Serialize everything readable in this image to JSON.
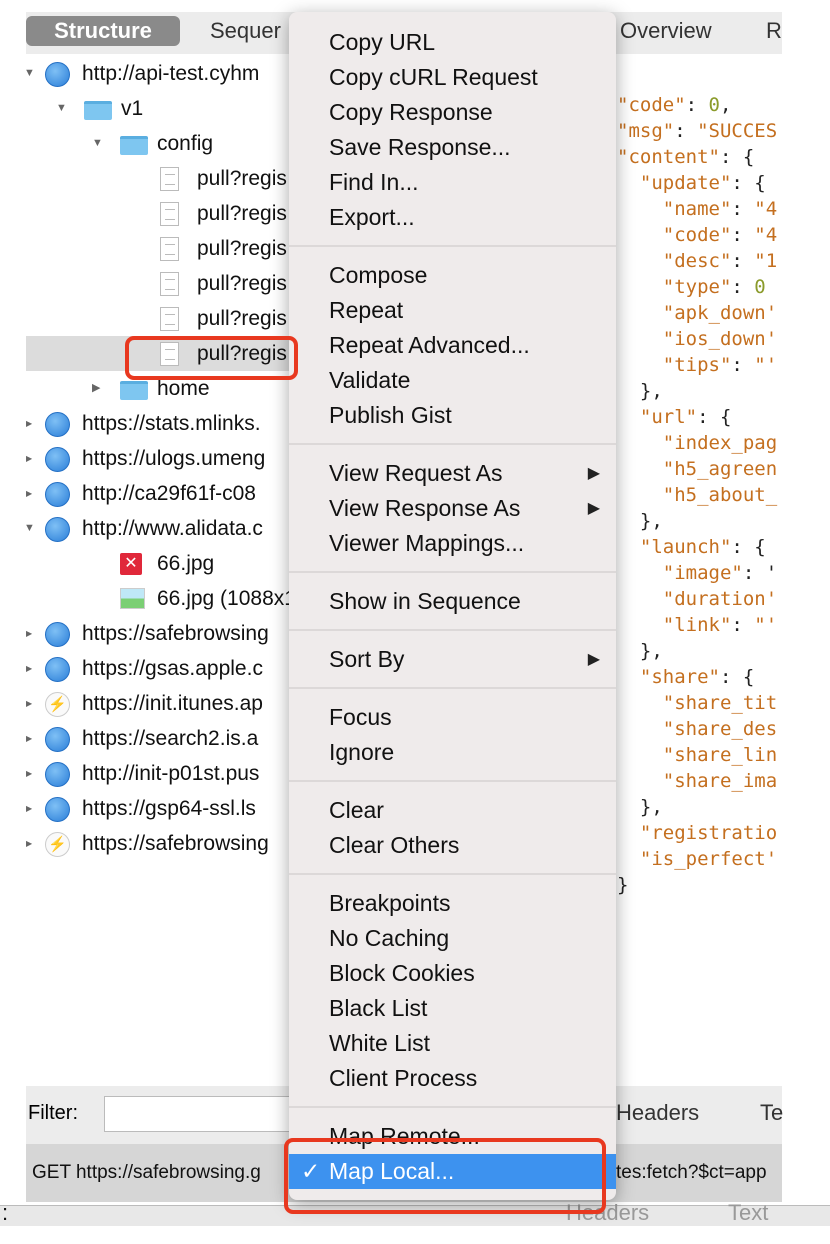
{
  "tabs": {
    "structure": "Structure",
    "sequence": "Sequer",
    "overview": "Overview",
    "r": "R"
  },
  "tree": [
    {
      "label": "http://api-test.cyhm",
      "icon": "globe",
      "indent": 0,
      "expanded": true
    },
    {
      "label": "v1",
      "icon": "folder",
      "indent": 1,
      "expanded": true
    },
    {
      "label": "config",
      "icon": "folder",
      "indent": 2,
      "expanded": true
    },
    {
      "label": "pull?regis",
      "icon": "doc",
      "indent": 3
    },
    {
      "label": "pull?regis",
      "icon": "doc",
      "indent": 3
    },
    {
      "label": "pull?regis",
      "icon": "doc",
      "indent": 3
    },
    {
      "label": "pull?regis",
      "icon": "doc",
      "indent": 3
    },
    {
      "label": "pull?regis",
      "icon": "doc",
      "indent": 3
    },
    {
      "label": "pull?regis",
      "icon": "doc",
      "indent": 3,
      "selected": true
    },
    {
      "label": "home",
      "icon": "folder",
      "indent": 2,
      "expanded": false
    },
    {
      "label": "https://stats.mlinks.",
      "icon": "globe",
      "indent": 0
    },
    {
      "label": "https://ulogs.umeng",
      "icon": "globe",
      "indent": 0
    },
    {
      "label": "http://ca29f61f-c08",
      "icon": "globe",
      "indent": 0
    },
    {
      "label": "http://www.alidata.c",
      "icon": "globe",
      "indent": 0,
      "expanded": true
    },
    {
      "label": "66.jpg",
      "icon": "error-image",
      "indent": 2
    },
    {
      "label": "66.jpg (1088x11",
      "icon": "image",
      "indent": 2
    },
    {
      "label": "https://safebrowsing",
      "icon": "globe",
      "indent": 0
    },
    {
      "label": "https://gsas.apple.c",
      "icon": "globe",
      "indent": 0
    },
    {
      "label": "https://init.itunes.ap",
      "icon": "bolt",
      "indent": 0
    },
    {
      "label": "https://search2.is.a",
      "icon": "globe",
      "indent": 0
    },
    {
      "label": "http://init-p01st.pus",
      "icon": "globe",
      "indent": 0
    },
    {
      "label": "https://gsp64-ssl.ls",
      "icon": "globe",
      "indent": 0
    },
    {
      "label": "https://safebrowsing",
      "icon": "bolt",
      "indent": 0
    }
  ],
  "json_lines": [
    [
      [
        "k",
        "\"code\""
      ],
      [
        "p",
        ": "
      ],
      [
        "n",
        "0"
      ],
      [
        "p",
        ","
      ]
    ],
    [
      [
        "k",
        "\"msg\""
      ],
      [
        "p",
        ": "
      ],
      [
        "k",
        "\"SUCCES"
      ]
    ],
    [
      [
        "k",
        "\"content\""
      ],
      [
        "p",
        ": {"
      ]
    ],
    [
      [
        "p",
        "  "
      ],
      [
        "k",
        "\"update\""
      ],
      [
        "p",
        ": {"
      ]
    ],
    [
      [
        "p",
        "    "
      ],
      [
        "k",
        "\"name\""
      ],
      [
        "p",
        ": "
      ],
      [
        "k",
        "\"4"
      ]
    ],
    [
      [
        "p",
        "    "
      ],
      [
        "k",
        "\"code\""
      ],
      [
        "p",
        ": "
      ],
      [
        "k",
        "\"4"
      ]
    ],
    [
      [
        "p",
        "    "
      ],
      [
        "k",
        "\"desc\""
      ],
      [
        "p",
        ": "
      ],
      [
        "k",
        "\"1"
      ]
    ],
    [
      [
        "p",
        "    "
      ],
      [
        "k",
        "\"type\""
      ],
      [
        "p",
        ": "
      ],
      [
        "n",
        "0"
      ]
    ],
    [
      [
        "p",
        "    "
      ],
      [
        "k",
        "\"apk_down'"
      ]
    ],
    [
      [
        "p",
        "    "
      ],
      [
        "k",
        "\"ios_down'"
      ]
    ],
    [
      [
        "p",
        "    "
      ],
      [
        "k",
        "\"tips\""
      ],
      [
        "p",
        ": "
      ],
      [
        "k",
        "\"'"
      ]
    ],
    [
      [
        "p",
        "  },"
      ]
    ],
    [
      [
        "p",
        "  "
      ],
      [
        "k",
        "\"url\""
      ],
      [
        "p",
        ": {"
      ]
    ],
    [
      [
        "p",
        "    "
      ],
      [
        "k",
        "\"index_pag"
      ]
    ],
    [
      [
        "p",
        "    "
      ],
      [
        "k",
        "\"h5_agreen"
      ]
    ],
    [
      [
        "p",
        "    "
      ],
      [
        "k",
        "\"h5_about_"
      ]
    ],
    [
      [
        "p",
        "  },"
      ]
    ],
    [
      [
        "p",
        "  "
      ],
      [
        "k",
        "\"launch\""
      ],
      [
        "p",
        ": {"
      ]
    ],
    [
      [
        "p",
        "    "
      ],
      [
        "k",
        "\"image\""
      ],
      [
        "p",
        ": '"
      ]
    ],
    [
      [
        "p",
        "    "
      ],
      [
        "k",
        "\"duration'"
      ]
    ],
    [
      [
        "p",
        "    "
      ],
      [
        "k",
        "\"link\""
      ],
      [
        "p",
        ": "
      ],
      [
        "k",
        "\"'"
      ]
    ],
    [
      [
        "p",
        "  },"
      ]
    ],
    [
      [
        "p",
        "  "
      ],
      [
        "k",
        "\"share\""
      ],
      [
        "p",
        ": {"
      ]
    ],
    [
      [
        "p",
        "    "
      ],
      [
        "k",
        "\"share_tit"
      ]
    ],
    [
      [
        "p",
        "    "
      ],
      [
        "k",
        "\"share_des"
      ]
    ],
    [
      [
        "p",
        "    "
      ],
      [
        "k",
        "\"share_lin"
      ]
    ],
    [
      [
        "p",
        "    "
      ],
      [
        "k",
        "\"share_ima"
      ]
    ],
    [
      [
        "p",
        "  },"
      ]
    ],
    [
      [
        "p",
        "  "
      ],
      [
        "k",
        "\"registratio"
      ]
    ],
    [
      [
        "p",
        "  "
      ],
      [
        "k",
        "\"is_perfect'"
      ]
    ],
    [
      [
        "p",
        "}"
      ]
    ]
  ],
  "menu": [
    [
      {
        "label": "Copy URL"
      },
      {
        "label": "Copy cURL Request"
      },
      {
        "label": "Copy Response"
      },
      {
        "label": "Save Response..."
      },
      {
        "label": "Find In..."
      },
      {
        "label": "Export..."
      }
    ],
    [
      {
        "label": "Compose"
      },
      {
        "label": "Repeat"
      },
      {
        "label": "Repeat Advanced..."
      },
      {
        "label": "Validate"
      },
      {
        "label": "Publish Gist"
      }
    ],
    [
      {
        "label": "View Request As",
        "submenu": true
      },
      {
        "label": "View Response As",
        "submenu": true
      },
      {
        "label": "Viewer Mappings..."
      }
    ],
    [
      {
        "label": "Show in Sequence"
      }
    ],
    [
      {
        "label": "Sort By",
        "submenu": true
      }
    ],
    [
      {
        "label": "Focus"
      },
      {
        "label": "Ignore"
      }
    ],
    [
      {
        "label": "Clear"
      },
      {
        "label": "Clear Others"
      }
    ],
    [
      {
        "label": "Breakpoints"
      },
      {
        "label": "No Caching"
      },
      {
        "label": "Block Cookies"
      },
      {
        "label": "Black List"
      },
      {
        "label": "White List"
      },
      {
        "label": "Client Process"
      }
    ],
    [
      {
        "label": "Map Remote..."
      },
      {
        "label": "Map Local...",
        "checked": true,
        "highlighted": true
      }
    ]
  ],
  "filter": {
    "label": "Filter:",
    "value": ""
  },
  "right_tabs": {
    "headers": "Headers",
    "text": "Te"
  },
  "status": {
    "left": "GET https://safebrowsing.g",
    "right": "tes:fetch?$ct=app"
  },
  "bottom": {
    "colon": ":",
    "headers": "Headers",
    "text": "Text"
  },
  "colors": {
    "highlight": "#3d92ef",
    "annotation": "#e8381f",
    "json_key": "#c46f1f",
    "json_number": "#8b9b2b"
  }
}
